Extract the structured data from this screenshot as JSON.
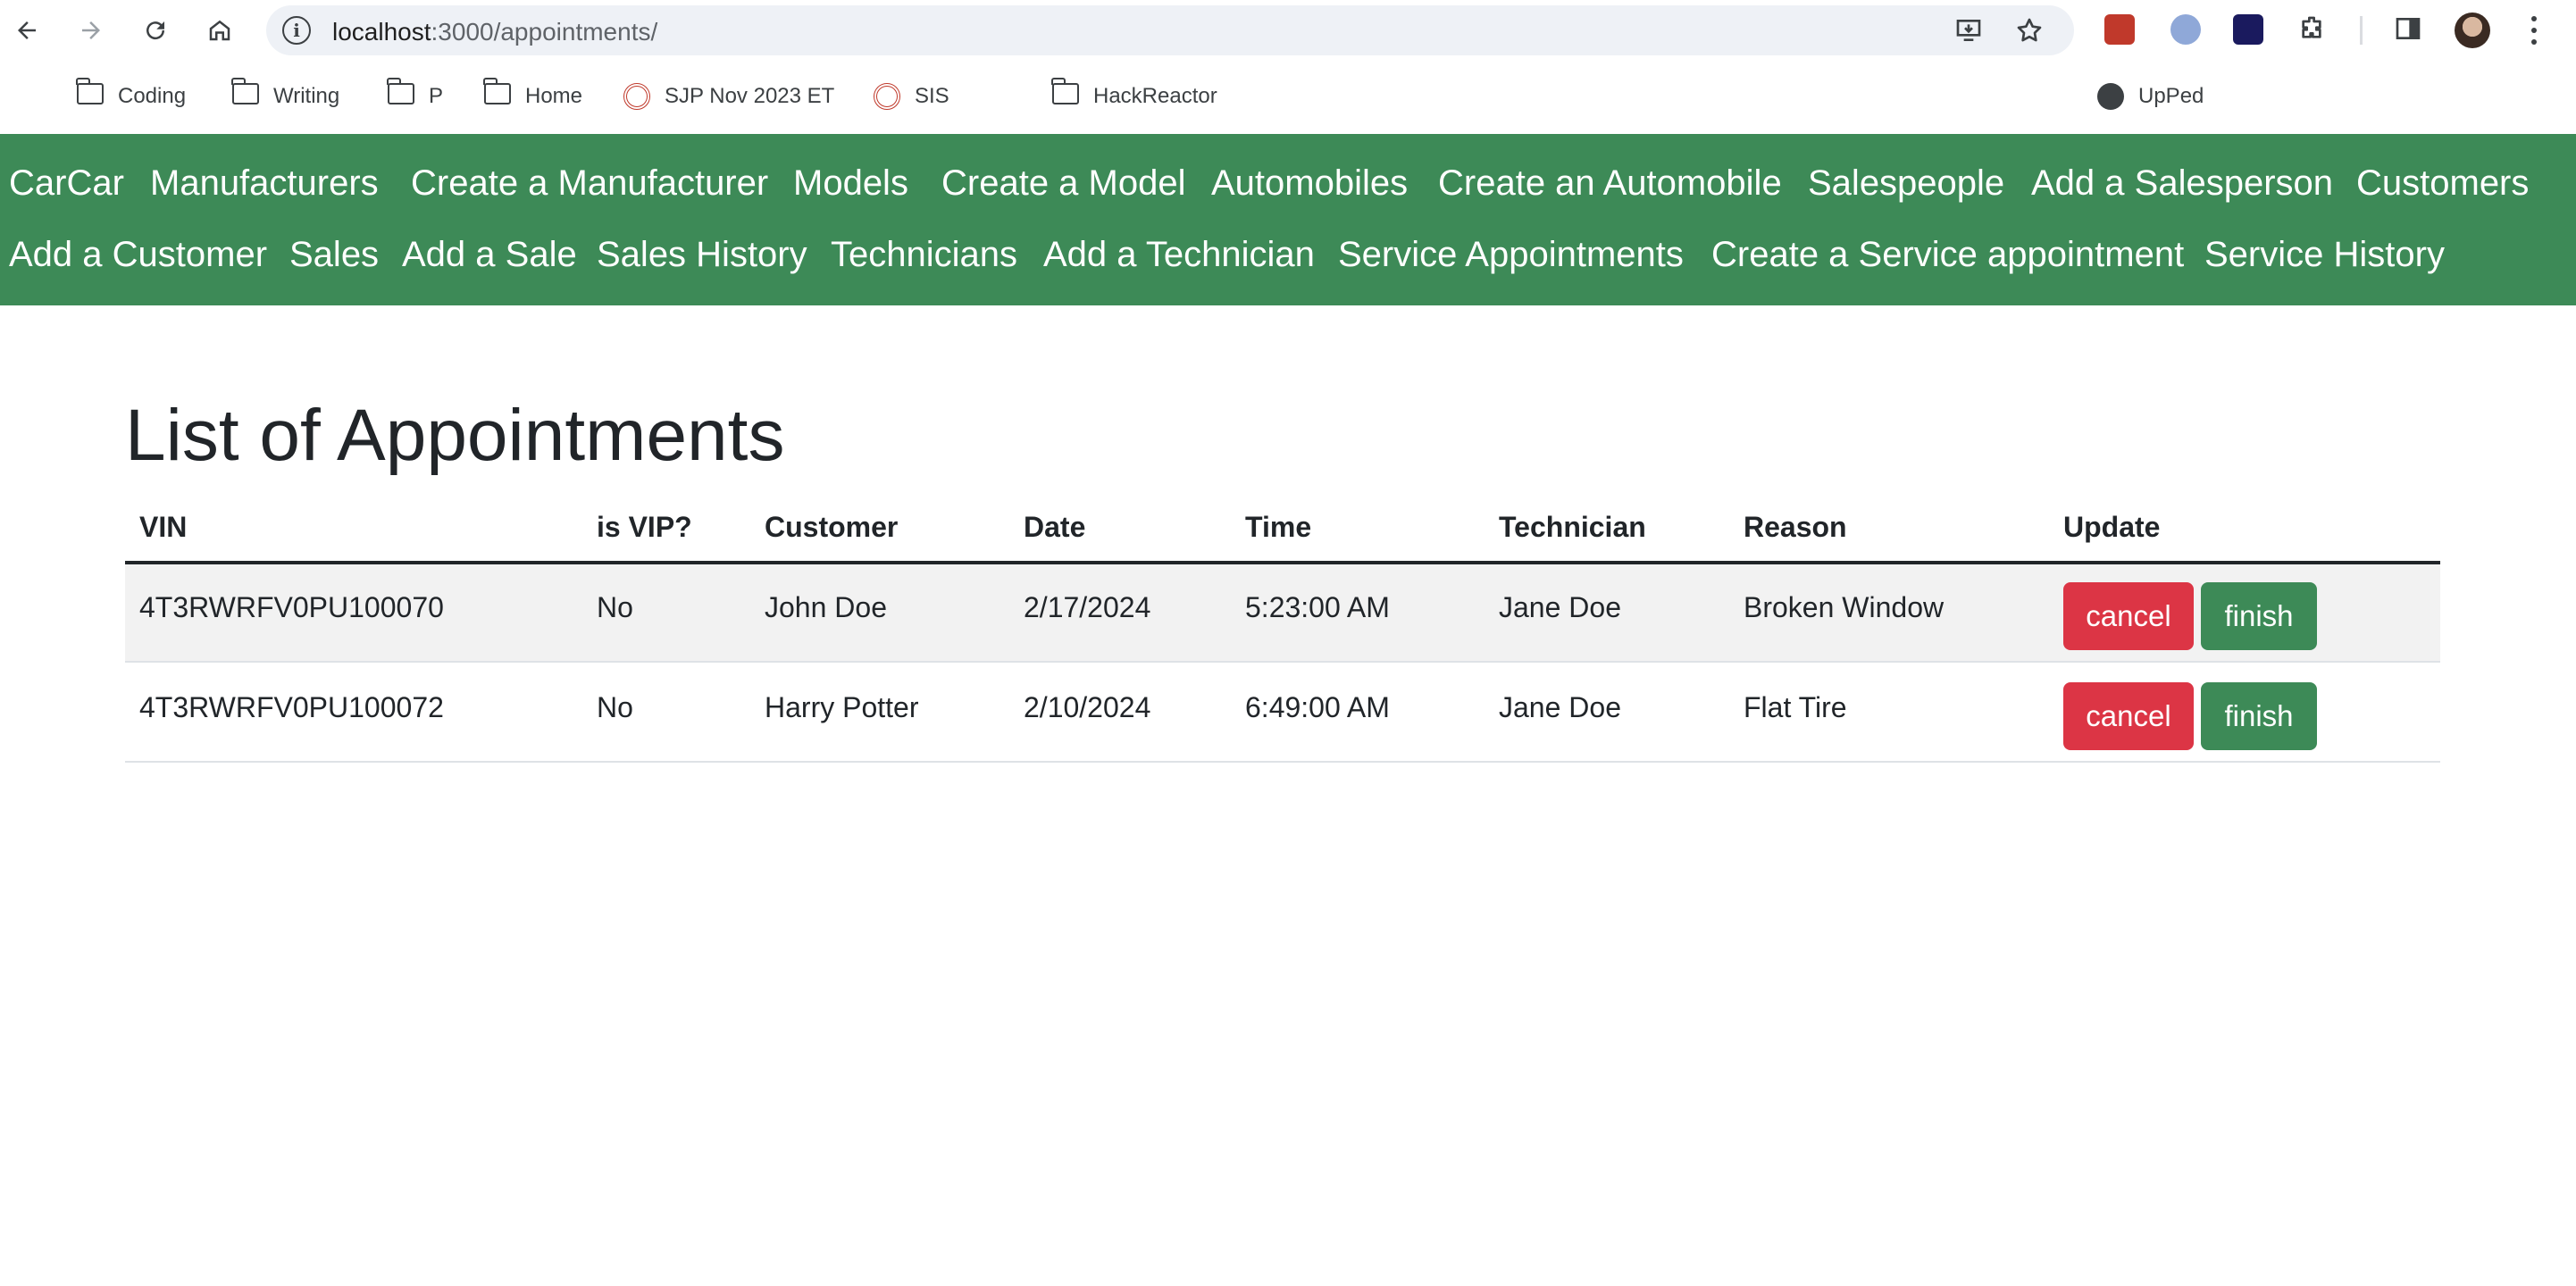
{
  "browser": {
    "url_host": "localhost",
    "url_path": ":3000/appointments/",
    "bookmarks": [
      {
        "label": "Coding",
        "icon": "folder-icon"
      },
      {
        "label": "Writing",
        "icon": "folder-icon"
      },
      {
        "label": "P",
        "icon": "folder-icon"
      },
      {
        "label": "Home",
        "icon": "folder-icon"
      },
      {
        "label": "SJP Nov 2023 ET",
        "icon": "spiral-icon"
      },
      {
        "label": "SIS",
        "icon": "spiral-icon"
      },
      {
        "label": "HackReactor",
        "icon": "folder-icon"
      },
      {
        "label": "UpPed",
        "icon": "globe-icon"
      }
    ]
  },
  "navbar": {
    "links": [
      "CarCar",
      "Manufacturers",
      "Create a Manufacturer",
      "Models",
      "Create a Model",
      "Automobiles",
      "Create an Automobile",
      "Salespeople",
      "Add a Salesperson",
      "Customers",
      "Add a Customer",
      "Sales",
      "Add a Sale",
      "Sales History",
      "Technicians",
      "Add a Technician",
      "Service Appointments",
      "Create a Service appointment",
      "Service History"
    ]
  },
  "main": {
    "title": "List of Appointments",
    "table": {
      "headers": [
        "VIN",
        "is VIP?",
        "Customer",
        "Date",
        "Time",
        "Technician",
        "Reason",
        "Update"
      ],
      "rows": [
        {
          "vin": "4T3RWRFV0PU100070",
          "vip": "No",
          "customer": "John Doe",
          "date": "2/17/2024",
          "time": "5:23:00 AM",
          "technician": "Jane Doe",
          "reason": "Broken Window"
        },
        {
          "vin": "4T3RWRFV0PU100072",
          "vip": "No",
          "customer": "Harry Potter",
          "date": "2/10/2024",
          "time": "6:49:00 AM",
          "technician": "Jane Doe",
          "reason": "Flat Tire"
        }
      ],
      "cancel_label": "cancel",
      "finish_label": "finish"
    }
  },
  "colors": {
    "navbar": "#3d8a57",
    "cancel": "#dc3545",
    "finish": "#3d8a57"
  }
}
